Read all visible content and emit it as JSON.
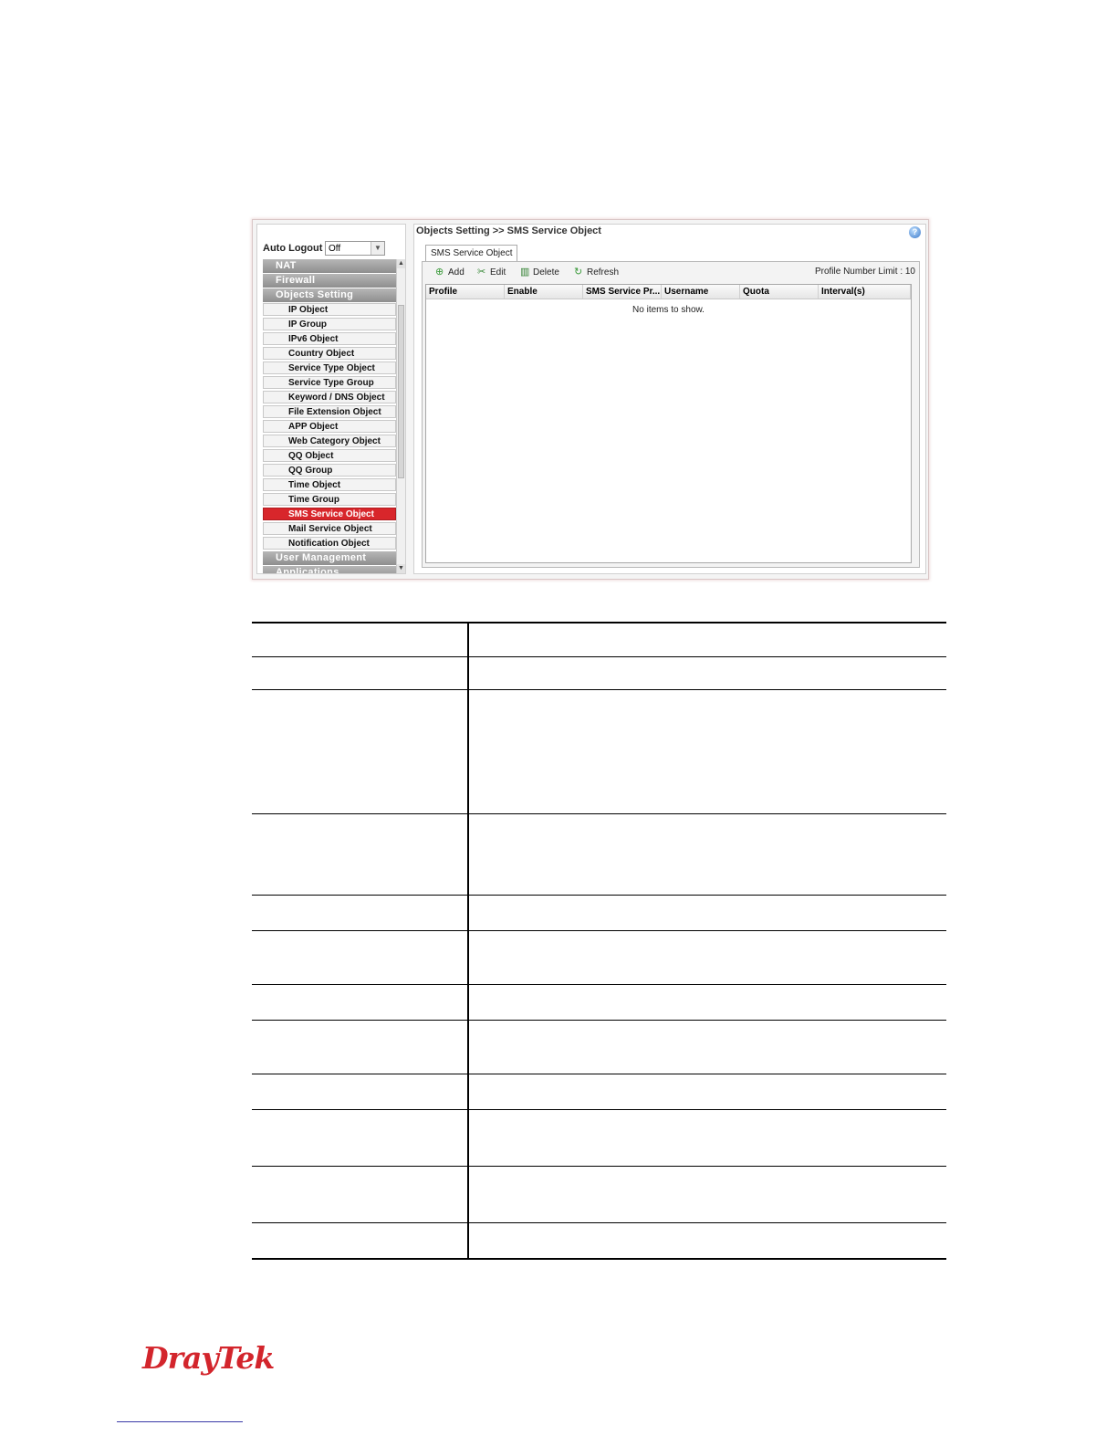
{
  "sidebar": {
    "auto_logout_label": "Auto Logout :",
    "auto_logout_value": "Off",
    "categories_top": [
      "NAT",
      "Firewall",
      "Objects Setting"
    ],
    "items": [
      "IP Object",
      "IP Group",
      "IPv6 Object",
      "Country Object",
      "Service Type Object",
      "Service Type Group",
      "Keyword / DNS Object",
      "File Extension Object",
      "APP Object",
      "Web Category Object",
      "QQ Object",
      "QQ Group",
      "Time Object",
      "Time Group",
      "SMS Service Object",
      "Mail Service Object",
      "Notification Object"
    ],
    "active_item": "SMS Service Object",
    "categories_bottom": [
      "User Management",
      "Applications"
    ]
  },
  "header": {
    "breadcrumb": "Objects Setting >> SMS Service Object",
    "help_icon": "?"
  },
  "tab": {
    "label": "SMS Service Object"
  },
  "toolbar": {
    "add": "Add",
    "edit": "Edit",
    "delete": "Delete",
    "refresh": "Refresh",
    "limit": "Profile Number Limit : 10"
  },
  "grid": {
    "columns": [
      "Profile",
      "Enable",
      "SMS Service Pr...",
      "Username",
      "Quota",
      "Interval(s)"
    ],
    "empty_message": "No items to show."
  },
  "footer": {
    "brand": "DrayTek"
  },
  "colors": {
    "accent": "#d8262b",
    "brand": "#d3252c"
  }
}
